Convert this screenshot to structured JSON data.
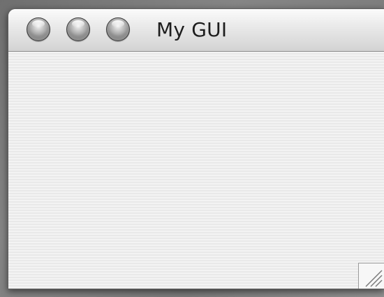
{
  "window": {
    "title": "My GUI",
    "buttons": {
      "close": "close-button",
      "minimize": "minimize-button",
      "zoom": "zoom-button"
    }
  },
  "icons": {
    "resize": "resize-grip-icon"
  }
}
